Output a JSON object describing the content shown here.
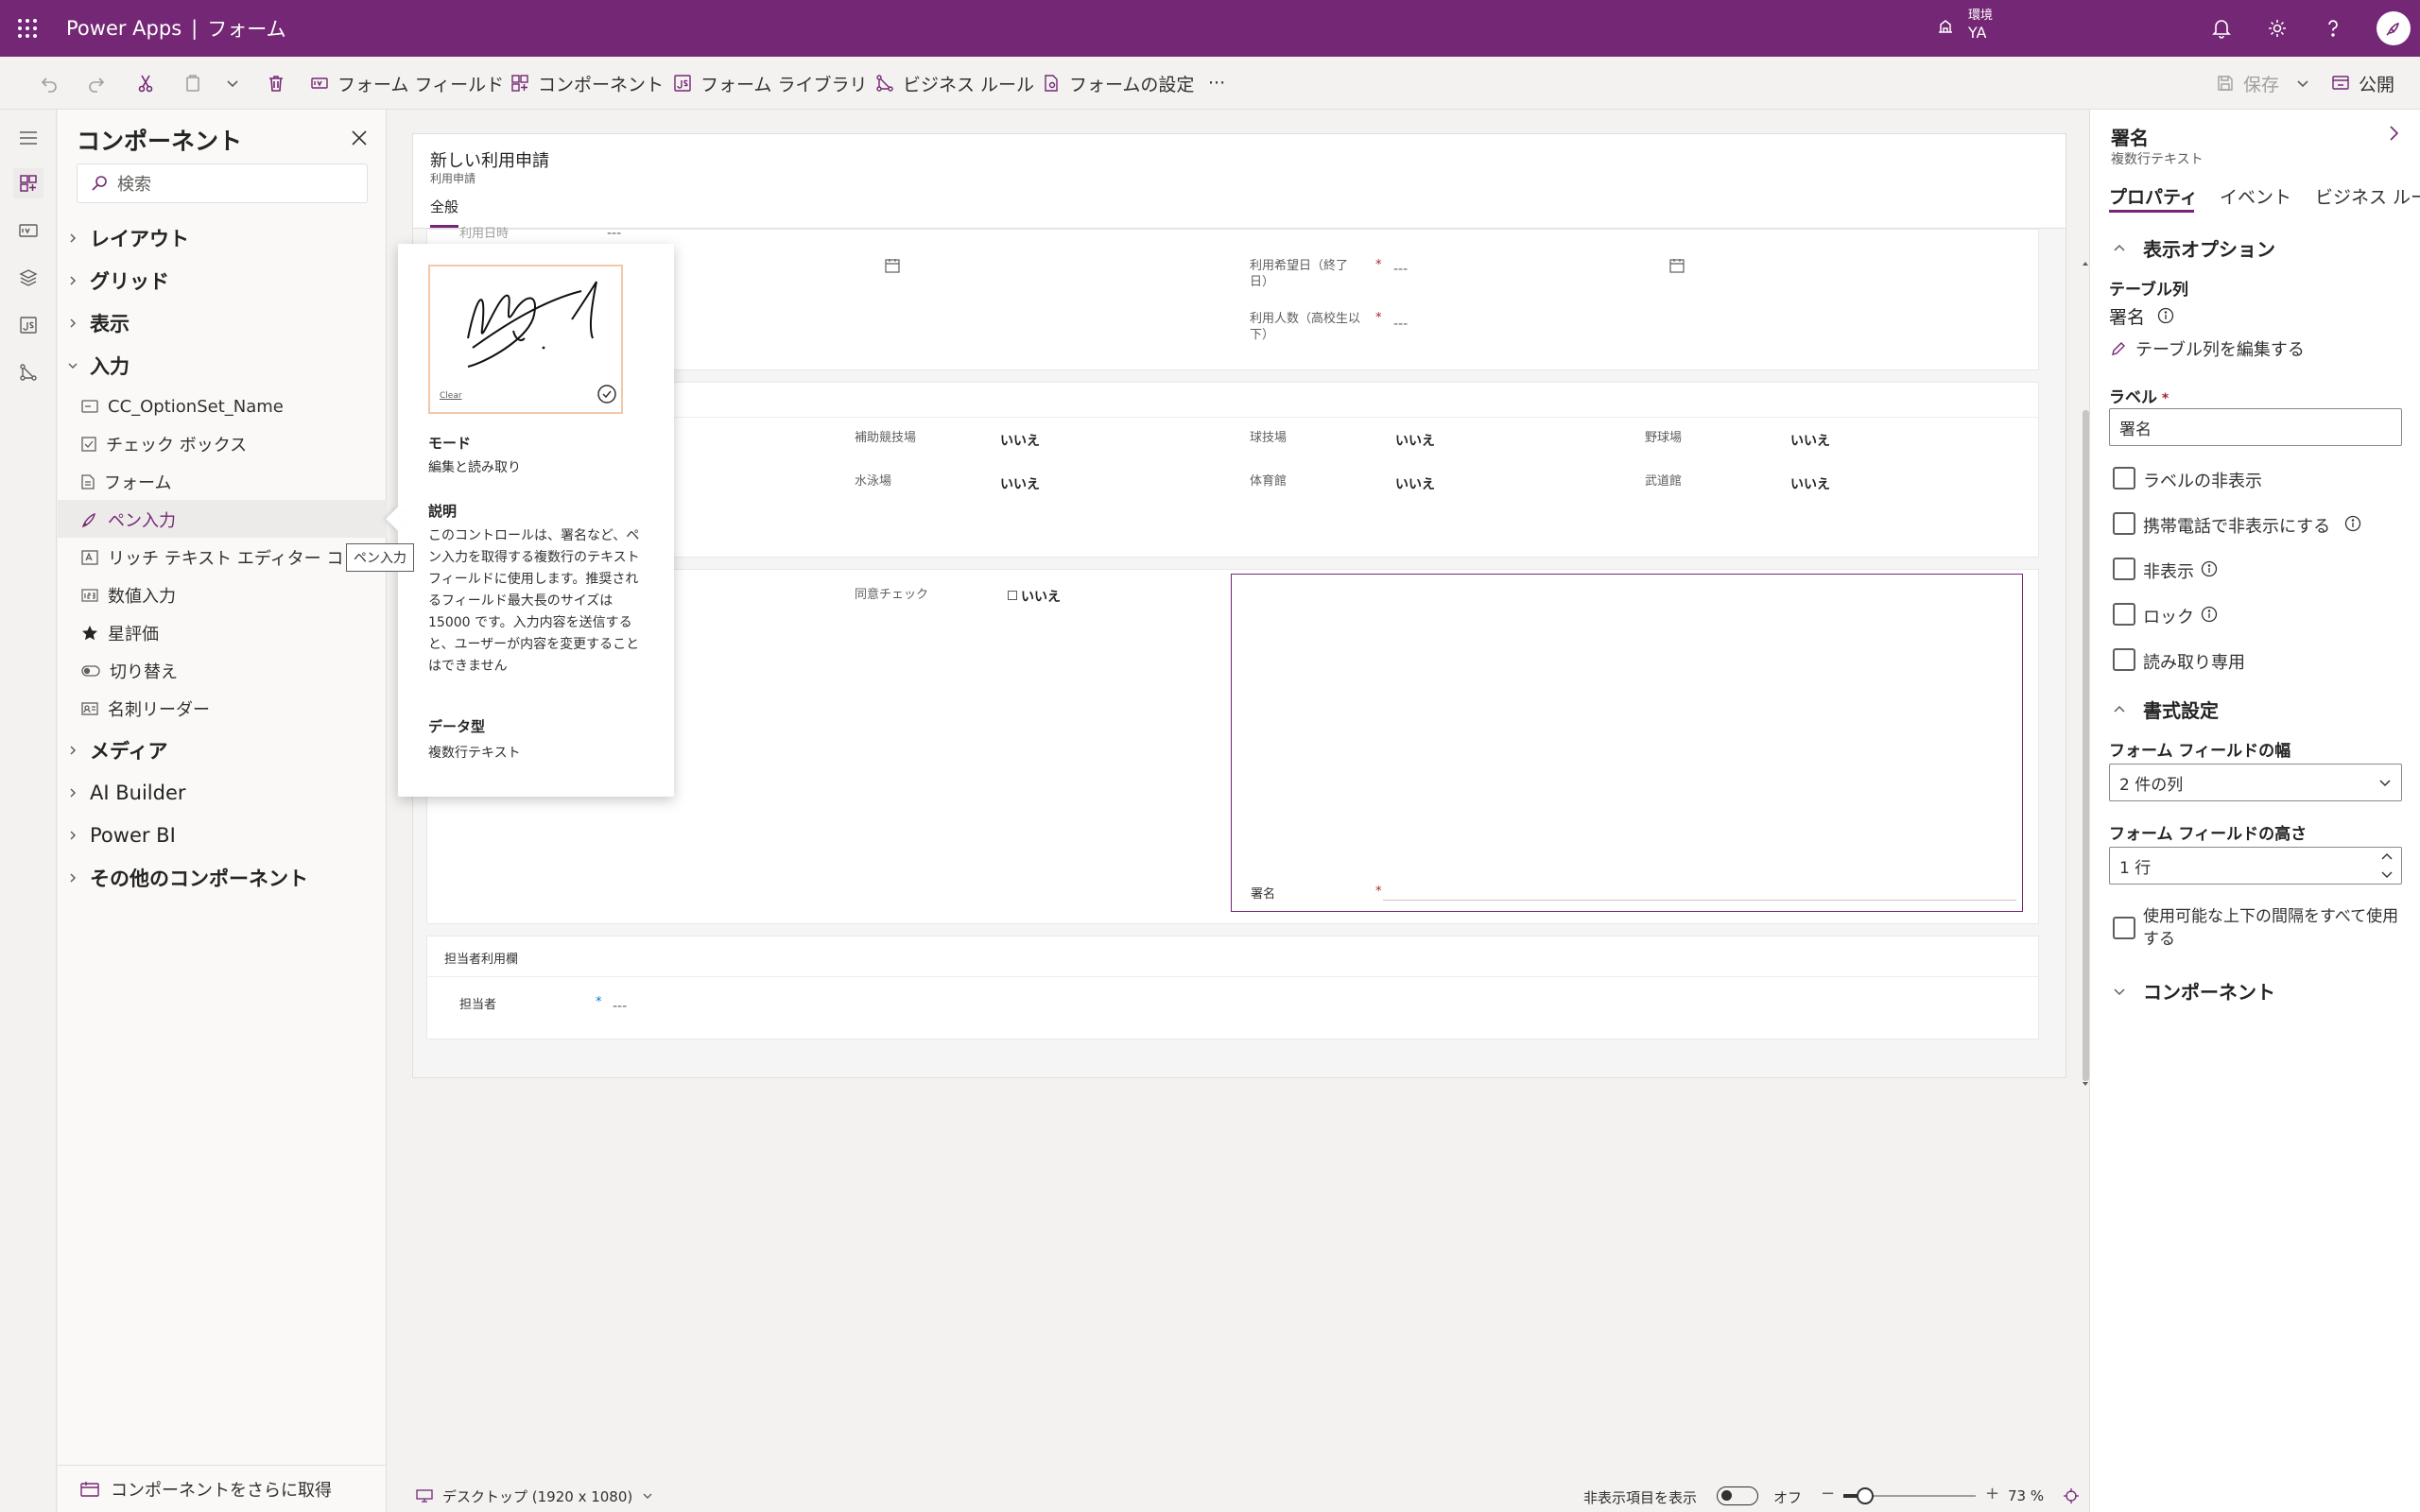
{
  "topbar": {
    "brand": "Power Apps",
    "separator": "|",
    "page": "フォーム",
    "env_label": "環境",
    "env_value": "YA",
    "accent": "#742774"
  },
  "commands": {
    "form_fields": "フォーム フィールド",
    "components": "コンポーネント",
    "form_library": "フォーム ライブラリ",
    "business_rules": "ビジネス ルール",
    "form_settings": "フォームの設定",
    "more": "···",
    "save": "保存",
    "publish": "公開"
  },
  "components_pane": {
    "title": "コンポーネント",
    "search_placeholder": "検索",
    "groups": {
      "layout": "レイアウト",
      "grid": "グリッド",
      "display": "表示",
      "input": "入力",
      "media": "メディア",
      "ai_builder": "AI Builder",
      "power_bi": "Power BI",
      "other": "その他のコンポーネント"
    },
    "input_items": [
      "CC_OptionSet_Name",
      "チェック ボックス",
      "フォーム",
      "ペン入力",
      "リッチ テキスト エディター コントロール",
      "数値入力",
      "星評価",
      "切り替え",
      "名刺リーダー"
    ],
    "tooltip": "ペン入力",
    "get_more": "コンポーネントをさらに取得"
  },
  "popover": {
    "clear": "Clear",
    "mode_heading": "モード",
    "mode": "編集と読み取り",
    "desc_heading": "説明",
    "description": "このコントロールは、署名など、ペン入力を取得する複数行のテキスト フィールドに使用します。推奨されるフィールド最大長のサイズは 15000 です。入力内容を送信すると、ユーザーが内容を変更することはできません",
    "type_heading": "データ型",
    "type": "複数行テキスト"
  },
  "form": {
    "title": "新しい利用申請",
    "subtitle": "利用申請",
    "tab": "全般",
    "top_cut_label": "利用日時",
    "top_cut_value": "---",
    "date_end_label": "利用希望日（終了日）",
    "people_label": "利用人数（高校生以下）",
    "dash": "---",
    "facilities": [
      {
        "label": "補助競技場",
        "value": "いいえ"
      },
      {
        "label": "球技場",
        "value": "いいえ"
      },
      {
        "label": "野球場",
        "value": "いいえ"
      },
      {
        "label": "水泳場",
        "value": "いいえ"
      },
      {
        "label": "体育館",
        "value": "いいえ"
      },
      {
        "label": "武道館",
        "value": "いいえ"
      }
    ],
    "consent_label": "同意チェック",
    "consent_value": "いいえ",
    "signature_label": "署名",
    "staff_section": "担当者利用欄",
    "staff_label": "担当者",
    "staff_value": "---"
  },
  "statusbar": {
    "device": "デスクトップ (1920 x 1080)",
    "show_hidden": "非表示項目を表示",
    "toggle": "オフ",
    "zoom": "73 %"
  },
  "right_pane": {
    "title": "署名",
    "subtitle": "複数行テキスト",
    "tabs": [
      "プロパティ",
      "イベント",
      "ビジネス ルール"
    ],
    "display_options": "表示オプション",
    "table_column_heading": "テーブル列",
    "table_column": "署名",
    "edit_column": "テーブル列を編集する",
    "label_heading": "ラベル",
    "label_value": "署名",
    "hide_label": "ラベルの非表示",
    "hide_mobile": "携帯電話で非表示にする",
    "hidden": "非表示",
    "lock": "ロック",
    "readonly": "読み取り専用",
    "formatting": "書式設定",
    "width_heading": "フォーム フィールドの幅",
    "width_value": "2 件の列",
    "height_heading": "フォーム フィールドの高さ",
    "height_value": "1 行",
    "use_space": "使用可能な上下の間隔をすべて使用する",
    "components": "コンポーネント"
  }
}
